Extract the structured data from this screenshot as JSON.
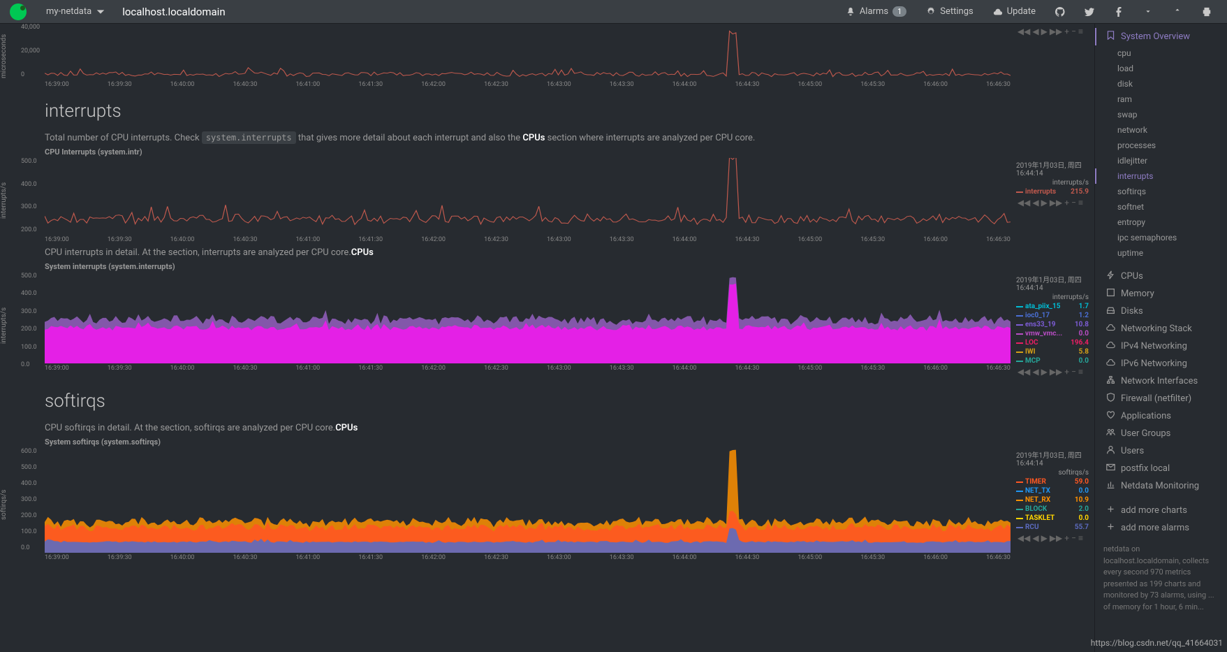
{
  "header": {
    "dropdown": "my-netdata",
    "hostname": "localhost.localdomain",
    "alarms_label": "Alarms",
    "alarms_count": "1",
    "settings_label": "Settings",
    "update_label": "Update"
  },
  "sidebar": {
    "top": {
      "label": "System Overview"
    },
    "subs": [
      {
        "label": "cpu"
      },
      {
        "label": "load"
      },
      {
        "label": "disk"
      },
      {
        "label": "ram"
      },
      {
        "label": "swap"
      },
      {
        "label": "network"
      },
      {
        "label": "processes"
      },
      {
        "label": "idlejitter"
      },
      {
        "label": "interrupts",
        "active": true
      },
      {
        "label": "softirqs"
      },
      {
        "label": "softnet"
      },
      {
        "label": "entropy"
      },
      {
        "label": "ipc semaphores"
      },
      {
        "label": "uptime"
      }
    ],
    "main": [
      {
        "label": "CPUs",
        "icon": "bolt"
      },
      {
        "label": "Memory",
        "icon": "square"
      },
      {
        "label": "Disks",
        "icon": "hdd"
      },
      {
        "label": "Networking Stack",
        "icon": "cloud"
      },
      {
        "label": "IPv4 Networking",
        "icon": "cloud"
      },
      {
        "label": "IPv6 Networking",
        "icon": "cloud"
      },
      {
        "label": "Network Interfaces",
        "icon": "sitemap"
      },
      {
        "label": "Firewall (netfilter)",
        "icon": "shield"
      },
      {
        "label": "Applications",
        "icon": "heart"
      },
      {
        "label": "User Groups",
        "icon": "users"
      },
      {
        "label": "Users",
        "icon": "user"
      },
      {
        "label": "postfix local",
        "icon": "envelope"
      },
      {
        "label": "Netdata Monitoring",
        "icon": "chart"
      }
    ],
    "add_charts": "add more charts",
    "add_alarms": "add more alarms",
    "footer": "netdata on localhost.localdomain, collects every second 970 metrics presented as 199 charts and monitored by 73 alarms, using ... of memory for 1 hour, 6 min..."
  },
  "chart_data": [
    {
      "title": "",
      "ylabel": "microseconds",
      "ylim": [
        0,
        60000
      ],
      "yticks": [
        "40,000",
        "20,000",
        "0"
      ],
      "xticks": [
        "16:39:00",
        "16:39:30",
        "16:40:00",
        "16:40:30",
        "16:41:00",
        "16:41:30",
        "16:42:00",
        "16:42:30",
        "16:43:00",
        "16:43:30",
        "16:44:00",
        "16:44:30",
        "16:45:00",
        "16:45:30",
        "16:46:00",
        "16:46:30"
      ],
      "series": [
        {
          "name": "",
          "color": "#c0594d"
        }
      ]
    },
    {
      "section_title": "interrupts",
      "desc_parts": {
        "p1": "Total number of CPU interrupts. Check ",
        "code": "system.interrupts",
        "p2": " that gives more detail about each interrupt and also the ",
        "b": "CPUs",
        "p3": " section where interrupts are analyzed per CPU core."
      },
      "title": "CPU Interrupts (system.intr)",
      "ylabel": "interrupts/s",
      "timestamp": "2019年1月03日, 周四\n16:44:14",
      "unit": "interrupts/s",
      "ylim": [
        200,
        550
      ],
      "yticks": [
        "500.0",
        "400.0",
        "300.0",
        "200.0"
      ],
      "xticks": [
        "16:39:00",
        "16:39:30",
        "16:40:00",
        "16:40:30",
        "16:41:00",
        "16:41:30",
        "16:42:00",
        "16:42:30",
        "16:43:00",
        "16:43:30",
        "16:44:00",
        "16:44:30",
        "16:45:00",
        "16:45:30",
        "16:46:00",
        "16:46:30"
      ],
      "series": [
        {
          "name": "interrupts",
          "color": "#c0594d",
          "value": "215.9"
        }
      ]
    },
    {
      "desc_parts": {
        "p1": "CPU interrupts in detail. At the ",
        "b": "CPUs",
        "p2": " section, interrupts are analyzed per CPU core."
      },
      "title": "System interrupts (system.interrupts)",
      "ylabel": "interrupts/s",
      "timestamp": "2019年1月03日, 周四\n16:44:14",
      "unit": "interrupts/s",
      "ylim": [
        0,
        550
      ],
      "yticks": [
        "500.0",
        "400.0",
        "300.0",
        "200.0",
        "100.0",
        "0.0"
      ],
      "xticks": [
        "16:39:00",
        "16:39:30",
        "16:40:00",
        "16:40:30",
        "16:41:00",
        "16:41:30",
        "16:42:00",
        "16:42:30",
        "16:43:00",
        "16:43:30",
        "16:44:00",
        "16:44:30",
        "16:45:00",
        "16:45:30",
        "16:46:00",
        "16:46:30"
      ],
      "series": [
        {
          "name": "ata_piix_15",
          "color": "#00bcd4",
          "value": "1.7"
        },
        {
          "name": "ioc0_17",
          "color": "#4a6fd4",
          "value": "1.2"
        },
        {
          "name": "ens33_19",
          "color": "#7c5cd4",
          "value": "10.8"
        },
        {
          "name": "vmw_vmc...",
          "color": "#b84dc4",
          "value": "0.0"
        },
        {
          "name": "LOC",
          "color": "#e91e63",
          "value": "196.4"
        },
        {
          "name": "IWI",
          "color": "#d4a017",
          "value": "5.8"
        },
        {
          "name": "MCP",
          "color": "#26a69a",
          "value": "0.0"
        }
      ]
    },
    {
      "section_title": "softirqs",
      "desc_parts": {
        "p1": "CPU softirqs in detail. At the ",
        "b": "CPUs",
        "p2": " section, softirqs are analyzed per CPU core."
      },
      "title": "System softirqs (system.softirqs)",
      "ylabel": "softirqs/s",
      "timestamp": "2019年1月03日, 周四\n16:44:14",
      "unit": "softirqs/s",
      "ylim": [
        0,
        650
      ],
      "yticks": [
        "600.0",
        "500.0",
        "400.0",
        "300.0",
        "200.0",
        "100.0",
        "0.0"
      ],
      "xticks": [
        "16:39:00",
        "16:39:30",
        "16:40:00",
        "16:40:30",
        "16:41:00",
        "16:41:30",
        "16:42:00",
        "16:42:30",
        "16:43:00",
        "16:43:30",
        "16:44:00",
        "16:44:30",
        "16:45:00",
        "16:45:30",
        "16:46:00",
        "16:46:30"
      ],
      "series": [
        {
          "name": "TIMER",
          "color": "#ff5722",
          "value": "59.0"
        },
        {
          "name": "NET_TX",
          "color": "#2196f3",
          "value": "0.0"
        },
        {
          "name": "NET_RX",
          "color": "#ff9100",
          "value": "10.9"
        },
        {
          "name": "BLOCK",
          "color": "#26a69a",
          "value": "2.0"
        },
        {
          "name": "TASKLET",
          "color": "#ffd600",
          "value": "0.0"
        },
        {
          "name": "RCU",
          "color": "#5c6bc0",
          "value": "55.7"
        }
      ]
    }
  ],
  "watermark": "https://blog.csdn.net/qq_41664031"
}
